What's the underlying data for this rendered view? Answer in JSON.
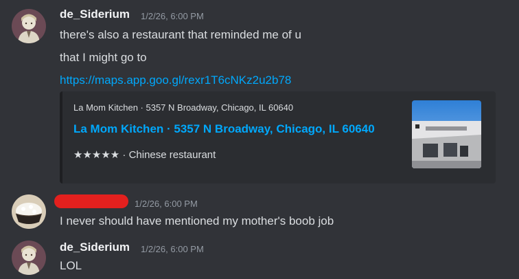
{
  "messages": [
    {
      "username": "de_Siderium",
      "timestamp": "1/2/26, 6:00 PM",
      "lines": [
        "there's also a restaurant that reminded me of u",
        "that I might go to"
      ],
      "link": "https://maps.app.goo.gl/rexr1T6cNKz2u2b78",
      "embed": {
        "provider": "La Mom Kitchen · 5357 N Broadway, Chicago, IL 60640",
        "title": "La Mom Kitchen · 5357 N Broadway, Chicago, IL 60640",
        "rating_stars": "★★★★★",
        "description": " · Chinese restaurant",
        "thumbnail": "restaurant-storefront-image"
      }
    },
    {
      "username": "[redacted]",
      "timestamp": "1/2/26, 6:00 PM",
      "lines": [
        "I never should have mentioned my mother's boob job"
      ]
    },
    {
      "username": "de_Siderium",
      "timestamp": "1/2/26, 6:00 PM",
      "lines": [
        "LOL"
      ]
    }
  ],
  "colors": {
    "background": "#313338",
    "embed_background": "#2b2d31",
    "link": "#00a8fc",
    "redaction": "#e3201e"
  }
}
